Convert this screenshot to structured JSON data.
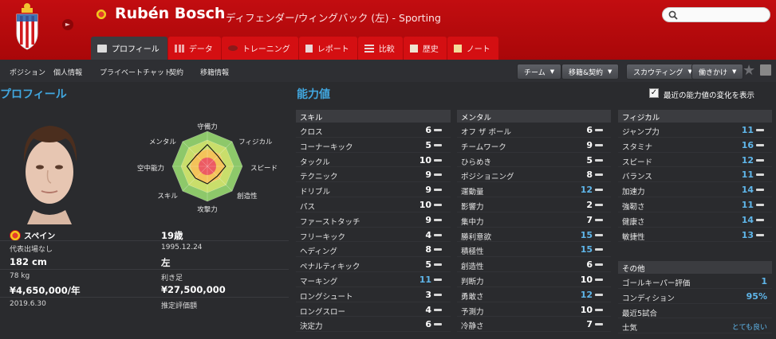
{
  "header": {
    "player_name": "Rubén Bosch",
    "subtitle": "ディフェンダー/ウィングバック (左) - Sporting",
    "club_crest_icon": "sporting-gijon-crest-icon",
    "accent_color": "#c20d10"
  },
  "tabs": [
    {
      "label": "プロフィール",
      "icon": "profile-card-icon",
      "active": true
    },
    {
      "label": "データ",
      "icon": "bar-chart-icon",
      "active": false
    },
    {
      "label": "トレーニング",
      "icon": "rugby-ball-icon",
      "active": false
    },
    {
      "label": "レポート",
      "icon": "document-icon",
      "active": false
    },
    {
      "label": "比較",
      "icon": "compare-list-icon",
      "active": false
    },
    {
      "label": "歴史",
      "icon": "history-book-icon",
      "active": false
    },
    {
      "label": "ノート",
      "icon": "note-icon",
      "active": false
    }
  ],
  "subnav": {
    "links": [
      "ポジション",
      "個人情報",
      "プライベートチャット",
      "契約",
      "移籍情報"
    ],
    "dropdowns": [
      "チーム",
      "移籍&契約",
      "スカウティング",
      "働きかけ"
    ]
  },
  "profile": {
    "title": "プロフィール",
    "nationality": "スペイン",
    "caps": "代表出場なし",
    "height": "182 cm",
    "weight": "78 kg",
    "wage": "¥4,650,000/年",
    "contract_end": "2019.6.30",
    "age": "19歳",
    "birthdate": "1995.12.24",
    "foot": "左",
    "foot_label": "利き足",
    "value": "¥27,500,000",
    "value_label": "推定評価額",
    "radar": {
      "labels": [
        "守備力",
        "フィジカル",
        "スピード",
        "創造性",
        "攻撃力",
        "スキル",
        "空中能力",
        "メンタル"
      ],
      "values": [
        0.62,
        0.42,
        0.52,
        0.4,
        0.5,
        0.48,
        0.58,
        0.44
      ]
    }
  },
  "abilities": {
    "title": "能力値",
    "show_changes_label": "最近の能力値の変化を表示",
    "show_changes": true,
    "skill": {
      "header": "スキル",
      "rows": [
        {
          "name": "クロス",
          "value": "6"
        },
        {
          "name": "コーナーキック",
          "value": "5"
        },
        {
          "name": "タックル",
          "value": "10"
        },
        {
          "name": "テクニック",
          "value": "9"
        },
        {
          "name": "ドリブル",
          "value": "9"
        },
        {
          "name": "パス",
          "value": "10"
        },
        {
          "name": "ファーストタッチ",
          "value": "9"
        },
        {
          "name": "フリーキック",
          "value": "4"
        },
        {
          "name": "ヘディング",
          "value": "8"
        },
        {
          "name": "ペナルティキック",
          "value": "5"
        },
        {
          "name": "マーキング",
          "value": "11"
        },
        {
          "name": "ロングシュート",
          "value": "3"
        },
        {
          "name": "ロングスロー",
          "value": "4"
        },
        {
          "name": "決定力",
          "value": "6"
        }
      ]
    },
    "mental": {
      "header": "メンタル",
      "rows": [
        {
          "name": "オフ ザ ボール",
          "value": "6"
        },
        {
          "name": "チームワーク",
          "value": "9"
        },
        {
          "name": "ひらめき",
          "value": "5"
        },
        {
          "name": "ポジショニング",
          "value": "8"
        },
        {
          "name": "運動量",
          "value": "12"
        },
        {
          "name": "影響力",
          "value": "2"
        },
        {
          "name": "集中力",
          "value": "7"
        },
        {
          "name": "勝利意欲",
          "value": "15"
        },
        {
          "name": "積極性",
          "value": "15"
        },
        {
          "name": "創造性",
          "value": "6"
        },
        {
          "name": "判断力",
          "value": "10"
        },
        {
          "name": "勇敢さ",
          "value": "12"
        },
        {
          "name": "予測力",
          "value": "10"
        },
        {
          "name": "冷静さ",
          "value": "7"
        }
      ]
    },
    "physical": {
      "header": "フィジカル",
      "rows": [
        {
          "name": "ジャンプ力",
          "value": "11"
        },
        {
          "name": "スタミナ",
          "value": "16"
        },
        {
          "name": "スピード",
          "value": "12"
        },
        {
          "name": "バランス",
          "value": "11"
        },
        {
          "name": "加速力",
          "value": "14"
        },
        {
          "name": "強靭さ",
          "value": "11"
        },
        {
          "name": "健康さ",
          "value": "14"
        },
        {
          "name": "敏捷性",
          "value": "13"
        }
      ]
    },
    "other": {
      "header": "その他",
      "rows": [
        {
          "name": "ゴールキーパー評価",
          "value": "1"
        },
        {
          "name": "コンディション",
          "value": "95%"
        },
        {
          "name": "最近5試合",
          "value": ""
        },
        {
          "name": "士気",
          "value": "とても良い"
        }
      ]
    },
    "colors": {
      "normal": "#ffffff",
      "good": "#5fb6ea"
    }
  }
}
